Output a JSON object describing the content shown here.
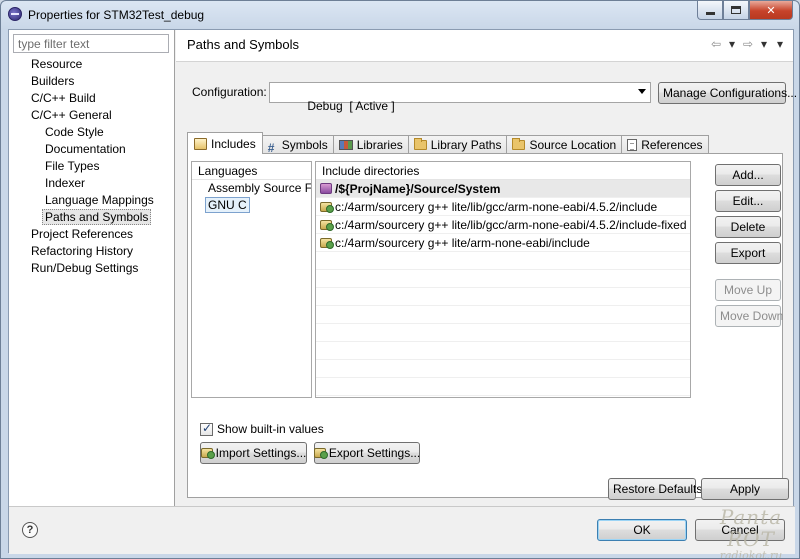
{
  "window": {
    "title": "Properties for STM32Test_debug"
  },
  "sidebar": {
    "filter_placeholder": "type filter text",
    "items": [
      {
        "label": "Resource",
        "level": 0
      },
      {
        "label": "Builders",
        "level": 0
      },
      {
        "label": "C/C++ Build",
        "level": 0
      },
      {
        "label": "C/C++ General",
        "level": 0
      },
      {
        "label": "Code Style",
        "level": 1
      },
      {
        "label": "Documentation",
        "level": 1
      },
      {
        "label": "File Types",
        "level": 1
      },
      {
        "label": "Indexer",
        "level": 1
      },
      {
        "label": "Language Mappings",
        "level": 1
      },
      {
        "label": "Paths and Symbols",
        "level": 1,
        "selected": true
      },
      {
        "label": "Project References",
        "level": 0
      },
      {
        "label": "Refactoring History",
        "level": 0
      },
      {
        "label": "Run/Debug Settings",
        "level": 0
      }
    ]
  },
  "page": {
    "title": "Paths and Symbols",
    "nav": {
      "back": "⇦",
      "back_menu": "▾",
      "forward": "⇨",
      "forward_menu": "▾",
      "view_menu": "▾"
    }
  },
  "config": {
    "label": "Configuration:",
    "value": "Debug  [ Active ]",
    "manage_label": "Manage Configurations..."
  },
  "tabs": [
    {
      "label": "Includes",
      "icon": "include-icon",
      "active": true
    },
    {
      "label": "Symbols",
      "icon": "hash-icon"
    },
    {
      "label": "Libraries",
      "icon": "books-icon"
    },
    {
      "label": "Library Paths",
      "icon": "folder-icon"
    },
    {
      "label": "Source Location",
      "icon": "folder-icon"
    },
    {
      "label": "References",
      "icon": "doc-icon"
    }
  ],
  "languages": {
    "header": "Languages",
    "items": [
      {
        "label": "Assembly Source File"
      },
      {
        "label": "GNU C",
        "selected": true
      }
    ]
  },
  "includes": {
    "header": "Include directories",
    "items": [
      {
        "path": "/${ProjName}/Source/System",
        "selected": true,
        "icon": "workspace-folder-icon"
      },
      {
        "path": "c:/4arm/sourcery g++ lite/lib/gcc/arm-none-eabi/4.5.2/include",
        "icon": "include-folder-icon"
      },
      {
        "path": "c:/4arm/sourcery g++ lite/lib/gcc/arm-none-eabi/4.5.2/include-fixed",
        "icon": "include-folder-icon"
      },
      {
        "path": "c:/4arm/sourcery g++ lite/arm-none-eabi/include",
        "icon": "include-folder-icon"
      }
    ]
  },
  "side_buttons": {
    "add": "Add...",
    "edit": "Edit...",
    "delete": "Delete",
    "export": "Export",
    "move_up": "Move Up",
    "move_down": "Move Down"
  },
  "show_builtin": {
    "label": "Show built-in values",
    "checked": true
  },
  "settings_buttons": {
    "import": "Import Settings...",
    "export": "Export Settings..."
  },
  "footer": {
    "restore_defaults": "Restore Defaults",
    "apply": "Apply",
    "ok": "OK",
    "cancel": "Cancel"
  },
  "watermark": {
    "line1": "Panta ROT",
    "line2": "radiokot.ru"
  }
}
